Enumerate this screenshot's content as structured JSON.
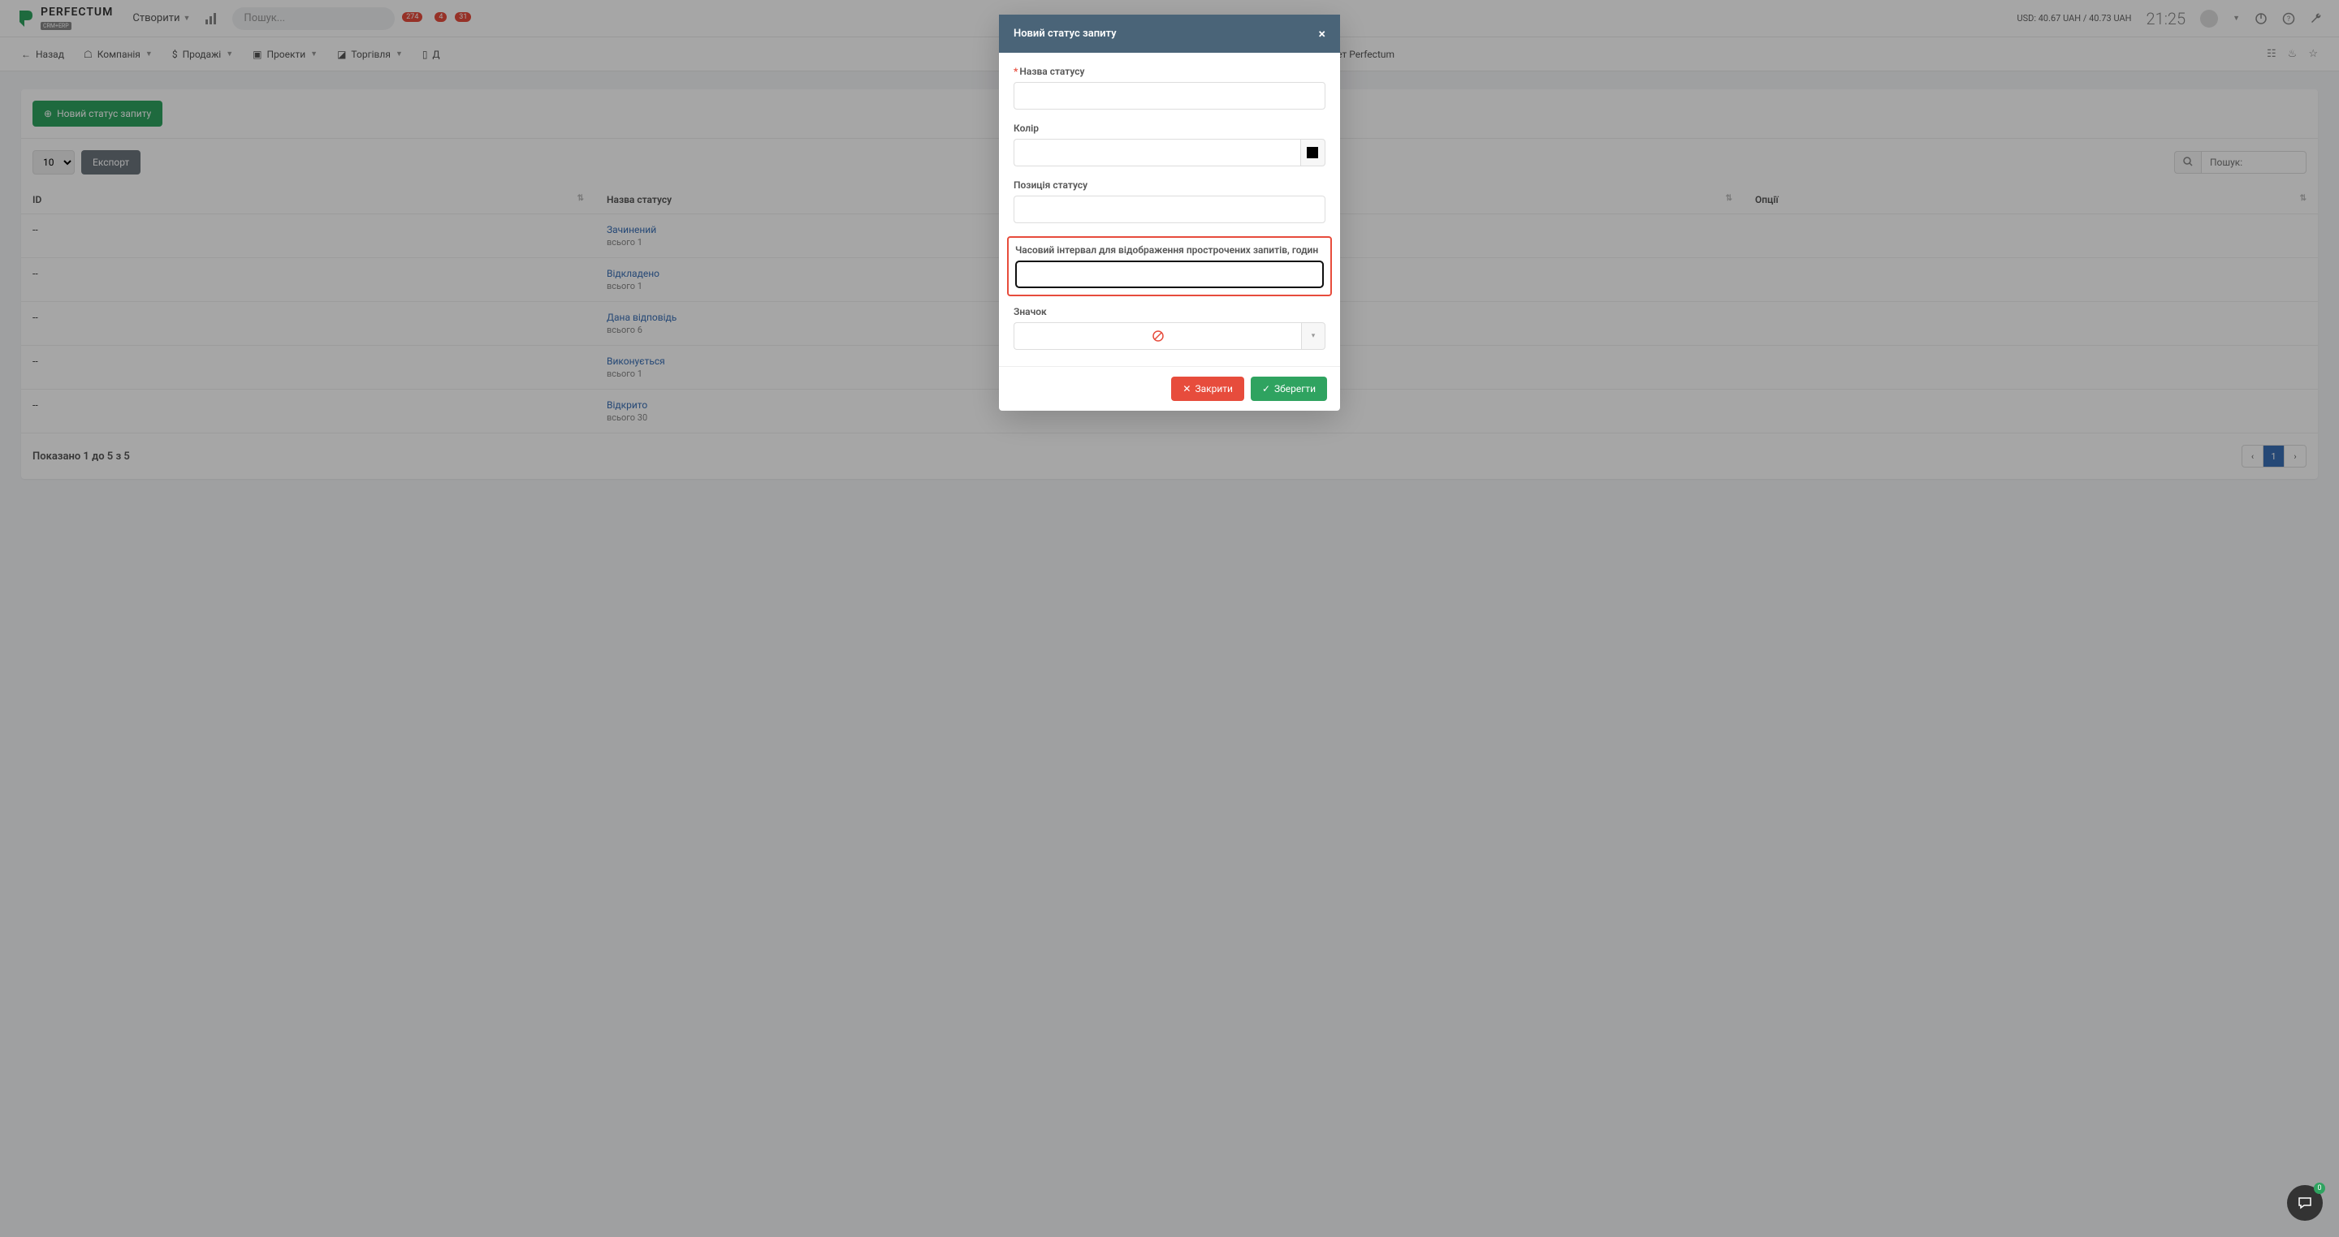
{
  "header": {
    "logo_name": "PERFECTUM",
    "logo_sub": "CRM+ERP",
    "create": "Створити",
    "search_placeholder": "Пошук...",
    "badges": [
      "274",
      "4",
      "31"
    ],
    "currency": "USD: 40.67 UAH / 40.73 UAH",
    "time": "21:25"
  },
  "nav": {
    "back": "Назад",
    "items": [
      "Компанія",
      "Продажі",
      "Проекти",
      "Торгівля",
      "Д"
    ],
    "right_label": "Кабінет Perfectum"
  },
  "panel": {
    "new_btn": "Новий статус запиту",
    "page_size": "10",
    "export": "Експорт",
    "search_placeholder": "Пошук:",
    "cols": {
      "id": "ID",
      "name": "Назва статусу",
      "options": "Опції"
    },
    "rows": [
      {
        "id": "--",
        "name": "Зачинений",
        "count": "всього 1"
      },
      {
        "id": "--",
        "name": "Відкладено",
        "count": "всього 1"
      },
      {
        "id": "--",
        "name": "Дана відповідь",
        "count": "всього 6"
      },
      {
        "id": "--",
        "name": "Виконується",
        "count": "всього 1"
      },
      {
        "id": "--",
        "name": "Відкрито",
        "count": "всього 30"
      }
    ],
    "footer_info": "Показано 1 до 5 з 5",
    "page_current": "1"
  },
  "modal": {
    "title": "Новий статус запиту",
    "labels": {
      "name": "Назва статусу",
      "color": "Колір",
      "position": "Позиція статусу",
      "interval": "Часовий інтервал для відображення прострочених запитів, годин",
      "icon": "Значок"
    },
    "close": "Закрити",
    "save": "Зберегти"
  },
  "chat_count": "0"
}
